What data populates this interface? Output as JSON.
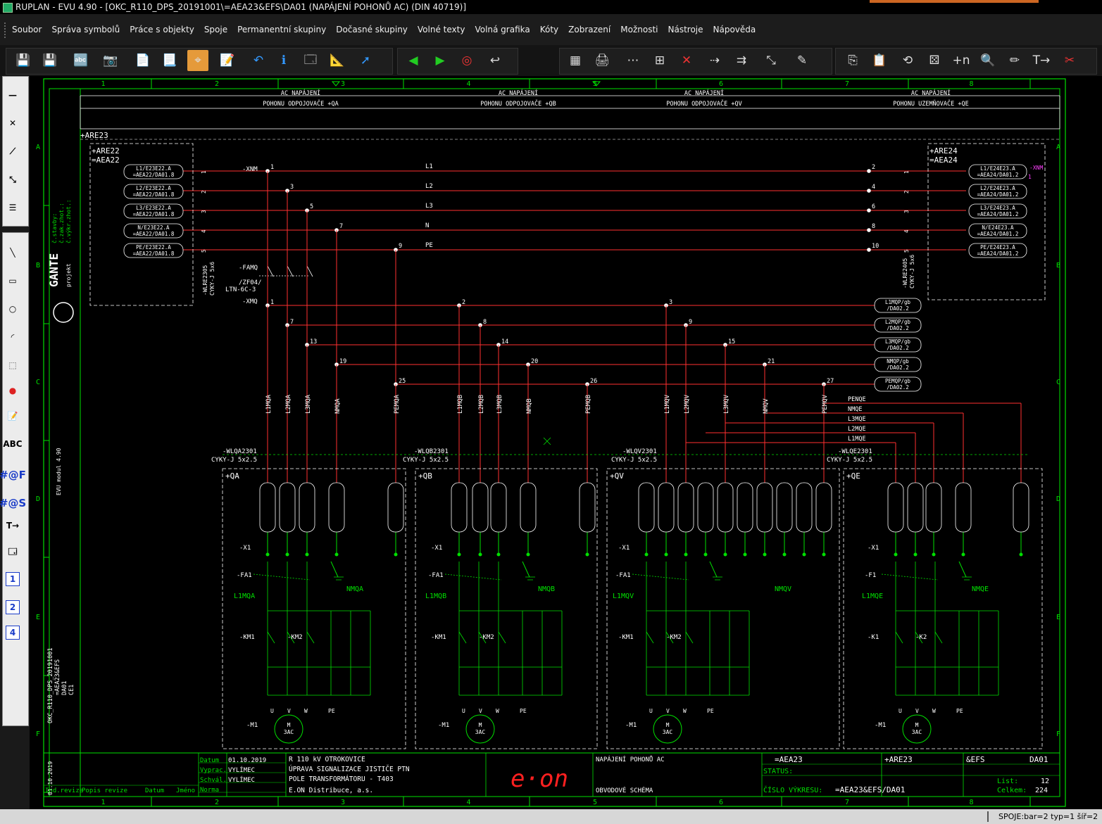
{
  "window": {
    "title": "RUPLAN - EVU 4.90    - [OKC_R110_DPS_20191001\\=AEA23&EFS\\DA01 (NAPÁJENÍ POHONŮ AC) (DIN 40719)]"
  },
  "menu": [
    "Soubor",
    "Správa symbolů",
    "Práce s objekty",
    "Spoje",
    "Permanentní skupiny",
    "Dočasné skupiny",
    "Volné texty",
    "Volná grafika",
    "Kóty",
    "Zobrazení",
    "Možnosti",
    "Nástroje",
    "Nápověda"
  ],
  "toolbar": {
    "icons": [
      "save-as-icon",
      "save-icon",
      "abc-text-icon",
      "camera-icon",
      "page-width-icon",
      "page-icon",
      "center-mark-icon",
      "form-icon",
      "undo-icon",
      "info-icon",
      "properties-icon",
      "measure-icon",
      "cursor-info-icon",
      "arrow-left-icon",
      "arrow-right-icon",
      "target-icon",
      "back-arrow-icon",
      "symbol-library-icon",
      "print-icon",
      "terminal-row-icon",
      "terminal-block-icon",
      "delete-connection-icon",
      "connection-join-icon",
      "connection-split-icon",
      "cable-icon",
      "pen-color-icon",
      "copy-icon",
      "paste-icon",
      "rotate-icon",
      "dice-icon",
      "plus-n-icon",
      "zoom-window-icon",
      "pencil-marker-icon",
      "text-arrow-icon",
      "cut-line-icon"
    ],
    "accent": "#e59a3a"
  },
  "left_tools": {
    "labels": [
      "ABC",
      "#@F",
      "#@S",
      "1",
      "2",
      "4"
    ],
    "icons": [
      "line-tool-icon",
      "terminal-tool-icon",
      "wire-tool-icon",
      "diagonal-wire-icon",
      "bus-tool-icon",
      "draw-line-icon",
      "rectangle-icon",
      "circle-icon",
      "arc-icon",
      "select-rect-icon",
      "color-icon",
      "form-edit-icon",
      "text-tool-icon",
      "font-icon",
      "symbol-font-icon",
      "text-arrow-tool-icon",
      "properties-tool-icon",
      "page-1-icon",
      "page-2-icon",
      "page-4-icon"
    ]
  },
  "colors": {
    "frame": "#00e000",
    "wire": "#ff3030",
    "text": "#ffffff",
    "magenta": "#ff40ff",
    "eon": "#ff2020",
    "grid": "#00c000"
  },
  "sheet": {
    "columns": [
      "1",
      "2",
      "3",
      "4",
      "5",
      "6",
      "7",
      "8"
    ],
    "rows": [
      "A",
      "B",
      "C",
      "D",
      "E",
      "F"
    ],
    "header_cells": [
      {
        "l1": "AC NAPÁJENÍ",
        "l2": "POHONU ODPOJOVAČE +QA"
      },
      {
        "l1": "AC NAPÁJENÍ",
        "l2": "POHONU ODPOJOVAČE +QB"
      },
      {
        "l1": "AC NAPÁJENÍ",
        "l2": "POHONU ODPOJOVAČE +QV"
      },
      {
        "l1": "AC NAPÁJENÍ",
        "l2": "POHONU UZEMŇOVAČE +QE"
      }
    ],
    "are23": "+ARE23",
    "box_left": {
      "l1": "+ARE22",
      "l2": "=AEA22"
    },
    "box_right": {
      "l1": "+ARE24",
      "l2": "=AEA24"
    },
    "left_refs": [
      {
        "a": "L1/E23E22.A",
        "b": "=AEA22/DA01.8",
        "n": "1"
      },
      {
        "a": "L2/E23E22.A",
        "b": "=AEA22/DA01.8",
        "n": "2"
      },
      {
        "a": "L3/E23E22.A",
        "b": "=AEA22/DA01.8",
        "n": "3"
      },
      {
        "a": "N/E23E22.A",
        "b": "=AEA22/DA01.8",
        "n": "4"
      },
      {
        "a": "PE/E23E22.A",
        "b": "=AEA22/DA01.8",
        "n": "5"
      }
    ],
    "right_refs": [
      {
        "a": "L1/E24E23.A",
        "b": "=AEA24/DA01.2"
      },
      {
        "a": "L2/E24E23.A",
        "b": "=AEA24/DA01.2"
      },
      {
        "a": "L3/E24E23.A",
        "b": "=AEA24/DA01.2"
      },
      {
        "a": "N/E24E23.A",
        "b": "=AEA24/DA01.2"
      },
      {
        "a": "PE/E24E23.A",
        "b": "=AEA24/DA01.2"
      }
    ],
    "right_marker": "-XNM",
    "right_marker_n": "1",
    "bus": [
      {
        "label": "L1",
        "lt": "1",
        "rt": "2"
      },
      {
        "label": "L2",
        "lt": "3",
        "rt": "4"
      },
      {
        "label": "L3",
        "lt": "5",
        "rt": "6"
      },
      {
        "label": "N",
        "lt": "7",
        "rt": "8"
      },
      {
        "label": "PE",
        "lt": "9",
        "rt": "10"
      }
    ],
    "xnm": "-XNM",
    "xmq": "-XMQ",
    "famq": "-FAMQ",
    "zf": "/ZF04/",
    "ltn": "LTN-6C-3",
    "cable_left": {
      "a": "-WLRE2305",
      "b": "CYKY-J 5x6"
    },
    "cable_right": {
      "a": "-WLRE2405",
      "b": "CYKY-J 5x6"
    },
    "ext_refs": [
      {
        "a": "L1MQP/gb",
        "b": "/DA02.2"
      },
      {
        "a": "L2MQP/gb",
        "b": "/DA02.2"
      },
      {
        "a": "L3MQP/gb",
        "b": "/DA02.2"
      },
      {
        "a": "NMQP/gb",
        "b": "/DA02.2"
      },
      {
        "a": "PEMQP/gb",
        "b": "/DA02.2"
      }
    ],
    "xmq_terms": [
      "1",
      "7",
      "13",
      "19",
      "25",
      "2",
      "8",
      "14",
      "20",
      "26",
      "3",
      "9",
      "15",
      "21",
      "27"
    ],
    "vlabels_qa": [
      "L1MQA",
      "L2MQA",
      "L3MQA",
      "NMQA",
      "PEMQA"
    ],
    "vlabels_qb": [
      "L1MQB",
      "L2MQB",
      "L3MQB",
      "NMQB",
      "PEMQB"
    ],
    "vlabels_qv": [
      "L1MQV",
      "L2MQV",
      "L3MQV",
      "NMQV",
      "PEMQV"
    ],
    "qe_bus": [
      "PENQE",
      "NMQE",
      "L3MQE",
      "L2MQE",
      "L1MQE"
    ],
    "cables": [
      {
        "a": "-WLQA2301",
        "b": "CYKY-J 5x2.5"
      },
      {
        "a": "-WLQB2301",
        "b": "CYKY-J 5x2.5"
      },
      {
        "a": "-WLQV2301",
        "b": "CYKY-J 5x2.5"
      },
      {
        "a": "-WLQE2301",
        "b": "CYKY-J 5x2.5"
      }
    ],
    "boxes": [
      "+QA",
      "+QB",
      "+QV",
      "+QE"
    ],
    "box_nmq": [
      "NMQA",
      "NMQB",
      "NMQV",
      "NMQE"
    ],
    "box_fuse_label": [
      "L1MQA",
      "L1MQB",
      "L1MQV",
      "L1MQE"
    ],
    "box_fa": [
      "-FA1",
      "-FA1",
      "-FA1",
      "-F1"
    ],
    "box_k1": [
      "-KM1",
      "-KM1",
      "-KM1",
      "-K1"
    ],
    "box_k2": [
      "-KM2",
      "-KM2",
      "-KM2",
      "-K2"
    ],
    "motor": {
      "ref": "-M1",
      "l1": "M",
      "l2": "3AC",
      "u": "U",
      "v": "V",
      "w": "W",
      "pe": "PE"
    },
    "x1": "-X1",
    "left_strip": {
      "a": "č.výkr.zhot.:",
      "b": "č.zak.zhot.:",
      "c": "č.stavby:",
      "logo": "GANTE",
      "logo2": "projekt",
      "evu": "EVU modul 4.90",
      "proj": "OKC_R110_DPS_20191001",
      "proj2": "=AEA23&EFS",
      "proj3": "DA01",
      "proj4": "CE1",
      "date": "01.10.2019"
    },
    "titleblock": {
      "datum_l": "Datum",
      "datum": "01.10.2019",
      "vypr_l": "Vyprac.",
      "vypr": "VYLÍMEC",
      "schv_l": "Schvál.",
      "schv": "VYLÍMEC",
      "norma_l": "Norma",
      "ind": "Ind.revize",
      "popis": "Popis revize",
      "datum2": "Datum",
      "jmeno": "Jméno",
      "line1": "R 110 kV OTROKOVICE",
      "line2": "ÚPRAVA SIGNALIZACE JISTIČE PTN",
      "line3": "POLE TRANSFORMÁTORU - T403",
      "line4": "E.ON Distribuce, a.s.",
      "logo": "e·on",
      "desc1": "NAPÁJENÍ POHONŮ AC",
      "desc2": "OBVODOVÉ SCHÉMA",
      "code1": "=AEA23",
      "code2": "+ARE23",
      "code3": "&EFS",
      "code4": "DA01",
      "status": "STATUS:",
      "cislo_l": "ČÍSLO VÝKRESU:",
      "cislo": "=AEA23&EFS/DA01",
      "list_l": "List:",
      "list": "12",
      "celkem_l": "Celkem:",
      "celkem": "224"
    }
  },
  "status": {
    "text": "SPOJE:bar=2  typ=1  šíř=2"
  }
}
